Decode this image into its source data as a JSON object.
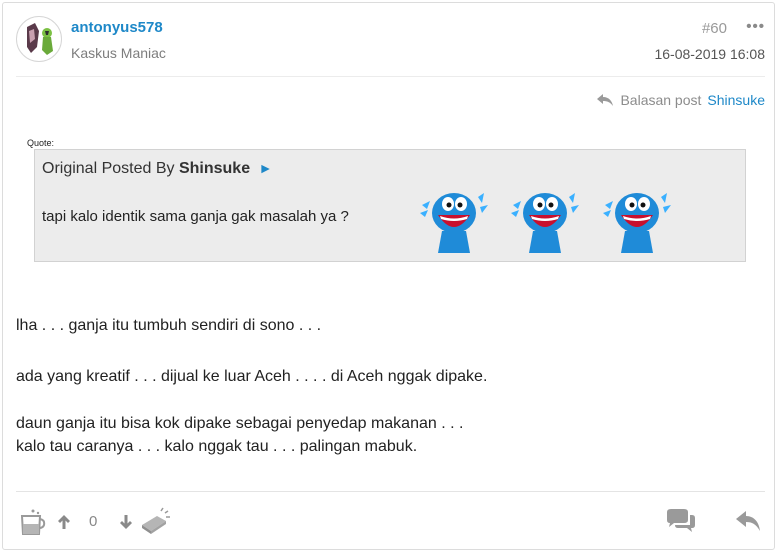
{
  "post": {
    "username": "antonyus578",
    "rank": "Kaskus Maniac",
    "number": "#60",
    "more": "•••",
    "date": "16-08-2019 16:08",
    "reply_prefix": "Balasan post",
    "reply_to": "Shinsuke"
  },
  "quote": {
    "label": "Quote:",
    "posted_by_prefix": "Original Posted By",
    "author": "Shinsuke",
    "arrow": "►",
    "text": "tapi kalo identik sama ganja gak masalah ya ?",
    "emoticons": [
      "ngakak-emoticon",
      "ngakak-emoticon",
      "ngakak-emoticon"
    ]
  },
  "body": {
    "line1": "lha . . . ganja itu tumbuh sendiri di sono . . .",
    "line2": "ada yang kreatif . . . dijual ke luar Aceh . . . . di Aceh nggak dipake.",
    "line3": "daun ganja itu bisa kok dipake sebagai penyedap makanan . . .",
    "line4": "kalo tau caranya . . . kalo nggak tau . . . palingan mabuk."
  },
  "footer": {
    "vote_count": "0",
    "icons": [
      "cendol-icon",
      "upvote-icon",
      "downvote-icon",
      "bata-icon",
      "comment-icon",
      "reply-icon"
    ]
  },
  "colors": {
    "link": "#1e88c8",
    "quote_bg": "#ececec",
    "emoticon_blue": "#1f8bd8"
  }
}
